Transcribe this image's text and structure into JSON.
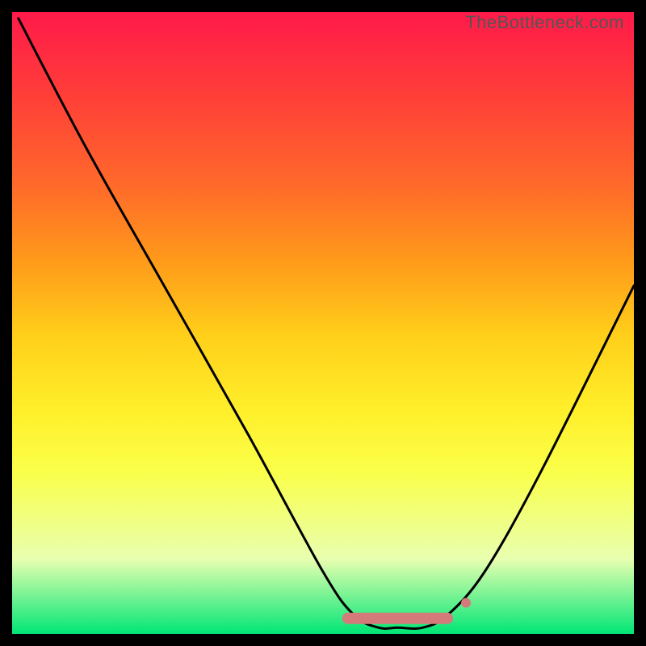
{
  "attribution": "TheBottleneck.com",
  "chart_data": {
    "type": "line",
    "title": "",
    "xlabel": "",
    "ylabel": "",
    "xlim": [
      0,
      100
    ],
    "ylim": [
      0,
      100
    ],
    "grid": false,
    "series": [
      {
        "name": "bottleneck-curve",
        "x": [
          1,
          12,
          25,
          38,
          50,
          55,
          59,
          62,
          66,
          70,
          76,
          85,
          100
        ],
        "y": [
          99,
          78,
          55,
          32,
          10,
          3,
          1,
          1,
          1,
          3,
          10,
          26,
          56
        ],
        "color": "#000000"
      }
    ],
    "annotations": [
      {
        "name": "optimal-marker",
        "type": "segment",
        "x": [
          54,
          70
        ],
        "y": [
          2.5,
          2.5
        ],
        "color": "#d57a7a",
        "width": 14,
        "cap": "round",
        "note": "short pinkish bar marking trough / optimal region"
      },
      {
        "name": "optimal-dot",
        "type": "point",
        "x": 73,
        "y": 5,
        "color": "#d57a7a",
        "radius": 6
      }
    ],
    "colors": {
      "gradient_top": "#ff1a4a",
      "gradient_mid": "#ffef2a",
      "gradient_bottom": "#00e676",
      "curve": "#000000",
      "marker": "#d57a7a",
      "frame": "#000000"
    }
  }
}
